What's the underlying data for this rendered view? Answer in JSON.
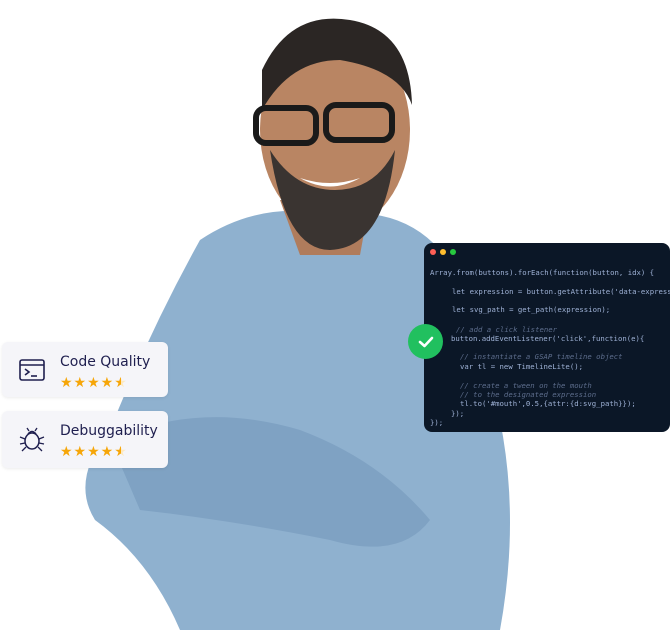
{
  "cards": [
    {
      "title": "Code Quality",
      "icon": "terminal-icon",
      "rating": 4.5
    },
    {
      "title": "Debuggability",
      "icon": "bug-icon",
      "rating": 4.5
    }
  ],
  "stars_text": "★★★★",
  "half_star": "★",
  "code_window": {
    "dots": [
      "#ff5f56",
      "#ffbd2e",
      "#27c93f"
    ],
    "lines": [
      "Array.from(buttons).forEach(function(button, idx) {",
      "let expression = button.getAttribute('data-expression",
      "let svg_path = get_path(expression);",
      "// add a click listener",
      "button.addEventListener('click',function(e){",
      "// instantiate a GSAP timeline object",
      "var tl = new TimelineLite();",
      "// create a tween on the mouth",
      "// to the designated expression",
      "tl.to('#mouth',0.5,{attr:{d:svg_path}});",
      "});",
      "});"
    ]
  },
  "colors": {
    "accent_green": "#21c05f",
    "star": "#f6a609",
    "code_bg": "#0b1727",
    "text_dark": "#1f1f4f"
  }
}
